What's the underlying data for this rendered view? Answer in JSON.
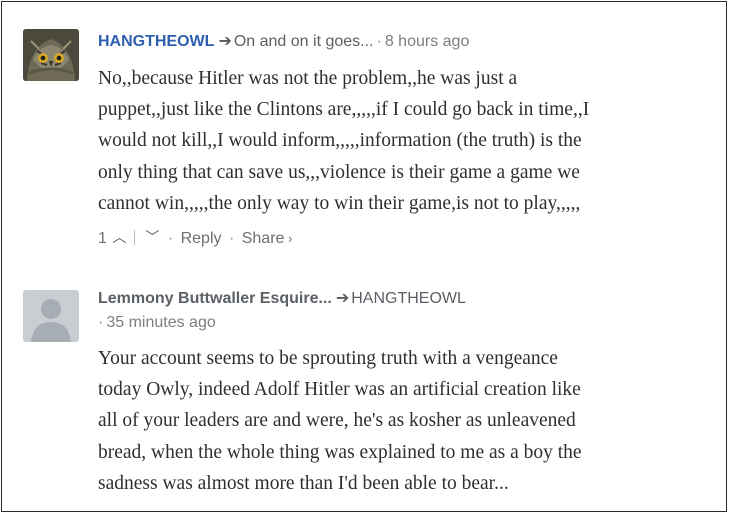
{
  "comments": [
    {
      "author": "HANGTHEOWL",
      "reply_to": "On and on it goes...",
      "time": "8 hours ago",
      "avatar": "owl-photo-avatar",
      "body_lines": [
        "No,,because Hitler was not the problem,,he was just a",
        "puppet,,just like the Clintons are,,,,,if I could go back in time,,I",
        "would not kill,,I would inform,,,,,information (the truth) is the",
        "only thing that can save us,,,violence is their game a game we",
        "cannot win,,,,,the only way to win their game,is not to play,,,,,"
      ],
      "votes": "1",
      "reply_label": "Reply",
      "share_label": "Share"
    },
    {
      "author": "Lemmony Buttwaller Esquire...",
      "reply_to": "HANGTHEOWL",
      "time": "35 minutes ago",
      "avatar": "generic-user-avatar",
      "body_lines": [
        "Your account seems to be sprouting truth with a vengeance",
        "today Owly, indeed Adolf Hitler was an artificial creation like",
        "all of your leaders are and were, he's as kosher as unleavened",
        "bread, when the whole thing was explained to me as a boy the",
        "sadness was almost more than I'd been able to bear..."
      ]
    }
  ],
  "colors": {
    "author_link": "#2e5fae",
    "meta_text": "#6b7075",
    "body_text": "#2f2f2f",
    "frame_border": "#2a2a2a"
  }
}
